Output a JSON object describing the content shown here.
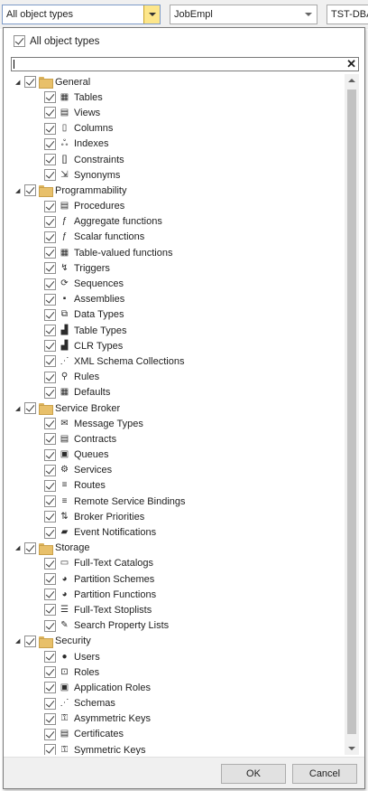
{
  "toolbar": {
    "object_type_combo": "All object types",
    "table_combo": "JobEmpl",
    "server_combo": "TST-DBA"
  },
  "popup": {
    "all_label": "All object types",
    "search_value": "",
    "ok_label": "OK",
    "cancel_label": "Cancel",
    "groups": [
      {
        "label": "General",
        "checked": true,
        "items": [
          {
            "label": "Tables",
            "icon": "table-icon",
            "checked": true
          },
          {
            "label": "Views",
            "icon": "view-icon",
            "checked": true
          },
          {
            "label": "Columns",
            "icon": "column-icon",
            "checked": true
          },
          {
            "label": "Indexes",
            "icon": "index-icon",
            "checked": true
          },
          {
            "label": "Constraints",
            "icon": "constraint-icon",
            "checked": true
          },
          {
            "label": "Synonyms",
            "icon": "synonym-icon",
            "checked": true
          }
        ]
      },
      {
        "label": "Programmability",
        "checked": true,
        "items": [
          {
            "label": "Procedures",
            "icon": "procedure-icon",
            "checked": true
          },
          {
            "label": "Aggregate functions",
            "icon": "aggregate-function-icon",
            "checked": true
          },
          {
            "label": "Scalar functions",
            "icon": "scalar-function-icon",
            "checked": true
          },
          {
            "label": "Table-valued functions",
            "icon": "table-valued-function-icon",
            "checked": true
          },
          {
            "label": "Triggers",
            "icon": "trigger-icon",
            "checked": true
          },
          {
            "label": "Sequences",
            "icon": "sequence-icon",
            "checked": true
          },
          {
            "label": "Assemblies",
            "icon": "assembly-icon",
            "checked": true
          },
          {
            "label": "Data Types",
            "icon": "data-type-icon",
            "checked": true
          },
          {
            "label": "Table Types",
            "icon": "table-type-icon",
            "checked": true
          },
          {
            "label": "CLR Types",
            "icon": "clr-type-icon",
            "checked": true
          },
          {
            "label": "XML Schema Collections",
            "icon": "xml-schema-icon",
            "checked": true
          },
          {
            "label": "Rules",
            "icon": "rule-icon",
            "checked": true
          },
          {
            "label": "Defaults",
            "icon": "default-icon",
            "checked": true
          }
        ]
      },
      {
        "label": "Service Broker",
        "checked": true,
        "items": [
          {
            "label": "Message Types",
            "icon": "message-type-icon",
            "checked": true
          },
          {
            "label": "Contracts",
            "icon": "contract-icon",
            "checked": true
          },
          {
            "label": "Queues",
            "icon": "queue-icon",
            "checked": true
          },
          {
            "label": "Services",
            "icon": "service-icon",
            "checked": true
          },
          {
            "label": "Routes",
            "icon": "route-icon",
            "checked": true
          },
          {
            "label": "Remote Service Bindings",
            "icon": "remote-binding-icon",
            "checked": true
          },
          {
            "label": "Broker Priorities",
            "icon": "broker-priority-icon",
            "checked": true
          },
          {
            "label": "Event Notifications",
            "icon": "event-notification-icon",
            "checked": true
          }
        ]
      },
      {
        "label": "Storage",
        "checked": true,
        "items": [
          {
            "label": "Full-Text Catalogs",
            "icon": "fulltext-catalog-icon",
            "checked": true
          },
          {
            "label": "Partition Schemes",
            "icon": "partition-scheme-icon",
            "checked": true
          },
          {
            "label": "Partition Functions",
            "icon": "partition-function-icon",
            "checked": true
          },
          {
            "label": "Full-Text Stoplists",
            "icon": "stoplist-icon",
            "checked": true
          },
          {
            "label": "Search Property Lists",
            "icon": "search-property-icon",
            "checked": true
          }
        ]
      },
      {
        "label": "Security",
        "checked": true,
        "items": [
          {
            "label": "Users",
            "icon": "user-icon",
            "checked": true
          },
          {
            "label": "Roles",
            "icon": "role-icon",
            "checked": true
          },
          {
            "label": "Application Roles",
            "icon": "application-role-icon",
            "checked": true
          },
          {
            "label": "Schemas",
            "icon": "schema-icon",
            "checked": true
          },
          {
            "label": "Asymmetric Keys",
            "icon": "asymmetric-key-icon",
            "checked": true
          },
          {
            "label": "Certificates",
            "icon": "certificate-icon",
            "checked": true
          },
          {
            "label": "Symmetric Keys",
            "icon": "symmetric-key-icon",
            "checked": true
          }
        ]
      }
    ]
  }
}
